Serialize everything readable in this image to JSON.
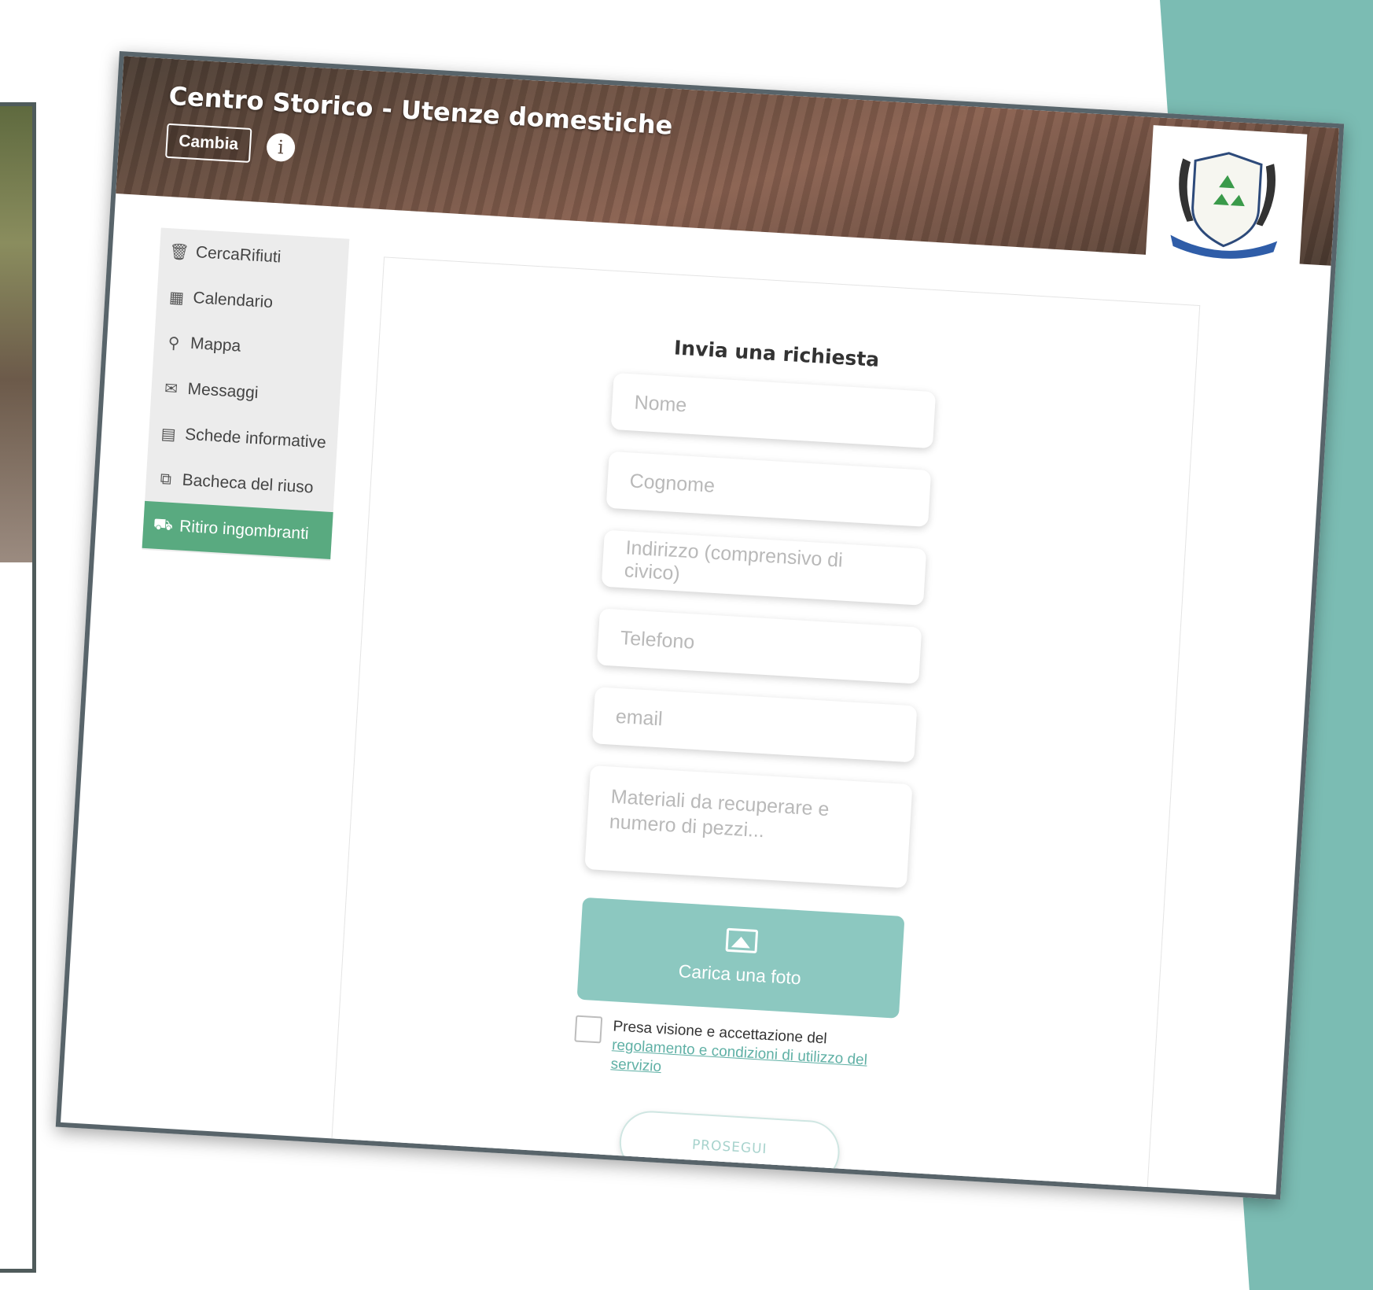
{
  "header": {
    "title": "Centro Storico - Utenze domestiche",
    "change_label": "Cambia",
    "info_icon": "info-icon",
    "crest_icon": "municipal-crest-recycling"
  },
  "sidebar": {
    "items": [
      {
        "label": "CercaRifiuti",
        "icon": "trash-icon",
        "glyph": "🗑",
        "active": false
      },
      {
        "label": "Calendario",
        "icon": "calendar-icon",
        "glyph": "▦",
        "active": false
      },
      {
        "label": "Mappa",
        "icon": "map-pin-icon",
        "glyph": "⚲",
        "active": false
      },
      {
        "label": "Messaggi",
        "icon": "envelope-icon",
        "glyph": "✉",
        "active": false
      },
      {
        "label": "Schede informative",
        "icon": "document-icon",
        "glyph": "▤",
        "active": false
      },
      {
        "label": "Bacheca del riuso",
        "icon": "share-icon",
        "glyph": "⧉",
        "active": false
      },
      {
        "label": "Ritiro ingombranti",
        "icon": "furniture-carry-icon",
        "glyph": "⛟",
        "active": true
      }
    ]
  },
  "form": {
    "title": "Invia una richiesta",
    "fields": {
      "nome": "Nome",
      "cognome": "Cognome",
      "indirizzo": "Indirizzo (comprensivo di civico)",
      "telefono": "Telefono",
      "email": "email",
      "materiali": "Materiali da recuperare e numero di pezzi..."
    },
    "upload_label": "Carica una foto",
    "consent_text": "Presa visione e accettazione del",
    "consent_link": "regolamento e condizioni di utilizzo del servizio",
    "submit_label": "PROSEGUI"
  },
  "colors": {
    "accent_green": "#59aa80",
    "upload_teal": "#8cc8c0",
    "frame_teal": "#7bbcb3"
  }
}
